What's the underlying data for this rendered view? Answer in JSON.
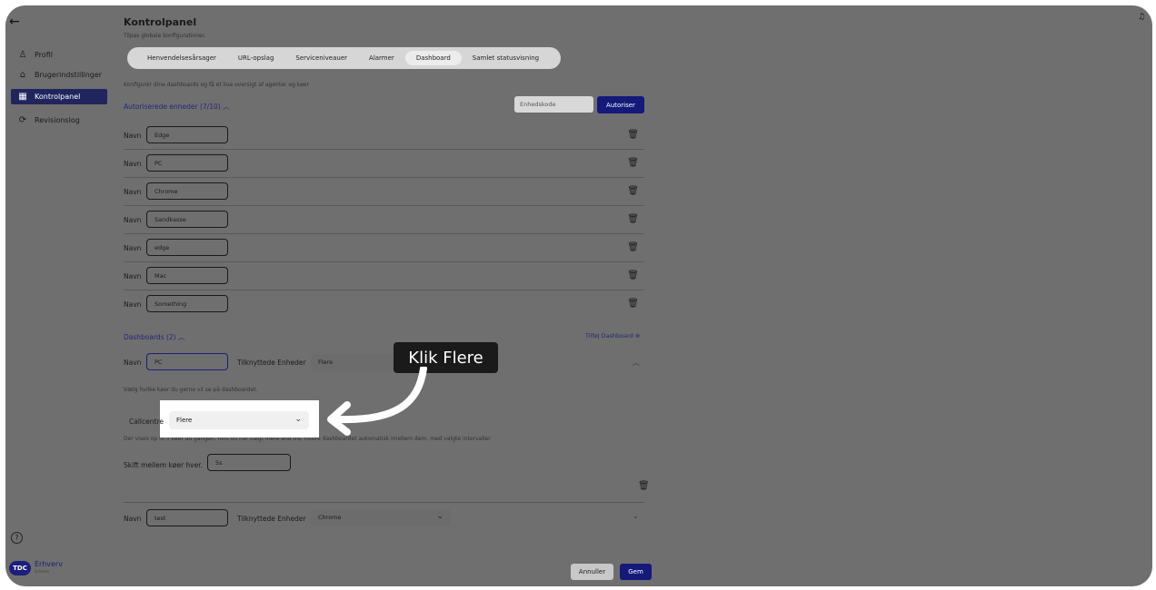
{
  "sidebar": {
    "items": [
      {
        "label": "Profil",
        "icon": "person-icon"
      },
      {
        "label": "Brugerindstillinger",
        "icon": "home-icon"
      },
      {
        "label": "Kontrolpanel",
        "icon": "panel-icon"
      },
      {
        "label": "Revisionslog",
        "icon": "refresh-icon"
      }
    ],
    "logo_text": "Erhverv",
    "logo_mark": "TDC",
    "logo_sub": "Scheme"
  },
  "header": {
    "title": "Kontrolpanel",
    "subtitle": "Tilpas globale konfigurationer."
  },
  "tabs": [
    "Henvendelsesårsager",
    "URL-opslag",
    "Serviceniveauer",
    "Alarmer",
    "Dashboard",
    "Samlet statusvisning"
  ],
  "active_tab": "Dashboard",
  "description": "Konfigurér dine dashboards og få et live oversigt af agenter og køer",
  "devices": {
    "heading": "Autoriserede enheder (7/10)",
    "code_placeholder": "Enhedskode",
    "authorize_label": "Autoriser",
    "name_label": "Navn",
    "rows": [
      "Edge",
      "PC",
      "Chrome",
      "Sandkasse",
      "edge",
      "Mac",
      "Something"
    ]
  },
  "dashboards": {
    "heading": "Dashboards (2)",
    "add_label": "Tilføj Dashboard",
    "name_label": "Navn",
    "linked_label": "Tilknyttede Enheder",
    "queue_note": "Vælg hvilke køer du gerne vil se på dashboardet.",
    "callcenter_label": "Callcentre",
    "callcenter_value": "Flere",
    "rotation_note": "Der vises op til 3 køer ad gangen, hvis du har valgt mere end tre, rotere dashboardet automatisk imellem dem, med valgte intervaller",
    "switch_label": "Skift mellem køer hver.",
    "switch_value": "5s",
    "items": [
      {
        "name": "PC",
        "linked": "Flere"
      },
      {
        "name": "test",
        "linked": "Chrome"
      }
    ]
  },
  "footer": {
    "cancel_label": "Annuller",
    "save_label": "Gem"
  },
  "tooltip": {
    "text": "Klik Flere"
  },
  "colors": {
    "accent": "#14197a",
    "overlay": "#6f6f6f"
  }
}
